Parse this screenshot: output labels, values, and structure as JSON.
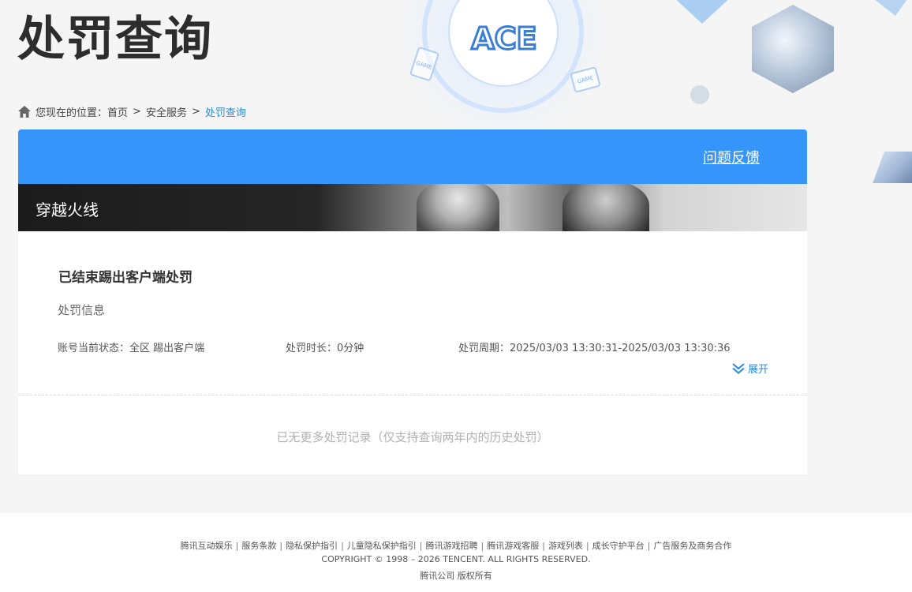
{
  "page": {
    "title": "处罚查询"
  },
  "breadcrumb": {
    "prefix": "您现在的位置：",
    "items": [
      "首页",
      "安全服务",
      "处罚查询"
    ],
    "separator": ">"
  },
  "header": {
    "feedback_label": "问题反馈",
    "accent_color": "#3695fb"
  },
  "banner": {
    "game_name": "穿越火线"
  },
  "record": {
    "title": "已结束踢出客户端处罚",
    "subtitle": "处罚信息",
    "status": "账号当前状态：全区 踢出客户端",
    "duration": "处罚时长：0分钟",
    "period": "处罚周期：2025/03/03 13:30:31-2025/03/03 13:30:36",
    "expand_label": "展开"
  },
  "no_more_text": "已无更多处罚记录（仅支持查询两年内的历史处罚）",
  "footer": {
    "links": [
      "腾讯互动娱乐",
      "服务条款",
      "隐私保护指引",
      "儿童隐私保护指引",
      "腾讯游戏招聘",
      "腾讯游戏客服",
      "游戏列表",
      "成长守护平台",
      "广告服务及商务合作"
    ],
    "separator": "|",
    "copyright": "COPYRIGHT © 1998 – 2026 TENCENT. ALL RIGHTS RESERVED.",
    "company": "腾讯公司 版权所有"
  },
  "deco": {
    "logo_text": "ACE",
    "game_card_text": "GAME"
  },
  "icons": {
    "home": "home-icon",
    "expand": "double-chevron-down-icon"
  }
}
